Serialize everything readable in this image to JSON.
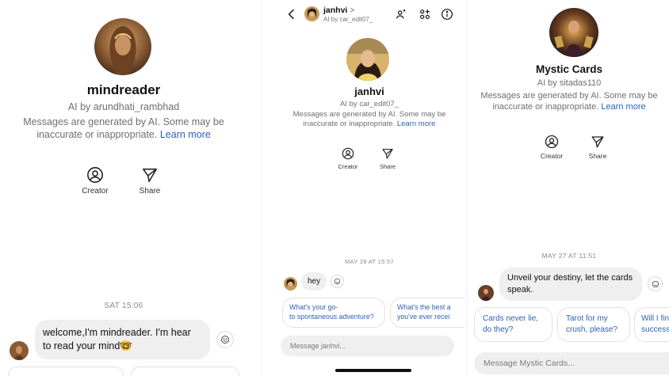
{
  "panel1": {
    "name": "mindreader",
    "creator_line": "AI by arundhati_rambhad",
    "disclaimer_line1": "Messages are generated by AI. Some may be",
    "disclaimer_line2": "inaccurate or inappropriate.",
    "learn_more": "Learn more",
    "actions": [
      {
        "label": "Creator",
        "icon": "person-circle-icon"
      },
      {
        "label": "Share",
        "icon": "paper-plane-icon"
      }
    ],
    "timestamp": "SAT 15:06",
    "message_line1": "welcome,I'm mindreader.  I'm hear",
    "message_line2": "to read your mind",
    "message_emoji": "🤓"
  },
  "panel2": {
    "header_name": "janhvi",
    "header_chevron": ">",
    "header_sub": "AI by car_edit07_",
    "name": "janhvi",
    "creator_line": "AI by car_edit07_",
    "disclaimer_line1": "Messages are generated by AI. Some may be",
    "disclaimer_line2": "inaccurate or inappropriate.",
    "learn_more": "Learn more",
    "actions": [
      {
        "label": "Creator",
        "icon": "person-circle-icon"
      },
      {
        "label": "Share",
        "icon": "paper-plane-icon"
      }
    ],
    "timestamp": "MAY 28 AT 15:57",
    "message": "hey",
    "suggestions": [
      {
        "line1": "What's your go-",
        "line2": "to spontaneous adventure?"
      },
      {
        "line1": "What's the best a",
        "line2": "you've ever recei"
      }
    ],
    "composer_placeholder": "Message janhvi..."
  },
  "panel3": {
    "name": "Mystic Cards",
    "creator_line": "AI by sitadas110",
    "disclaimer_line1": "Messages are generated by AI. Some may be",
    "disclaimer_line2": "inaccurate or inappropriate.",
    "learn_more": "Learn more",
    "actions": [
      {
        "label": "Creator",
        "icon": "person-circle-icon"
      },
      {
        "label": "Share",
        "icon": "paper-plane-icon"
      }
    ],
    "timestamp": "MAY 27 AT 11:51",
    "message_line1": "Unveil your destiny, let the cards",
    "message_line2": "speak.",
    "suggestions": [
      {
        "line1": "Cards never lie,",
        "line2": "do they?"
      },
      {
        "line1": "Tarot for my",
        "line2": "crush, please?"
      },
      {
        "line1": "Will I fin",
        "line2": "success"
      }
    ],
    "composer_placeholder": "Message Mystic Cards..."
  },
  "colors": {
    "link": "#2f5fb5",
    "bubble": "#efefef",
    "muted": "#6f6f6f"
  }
}
